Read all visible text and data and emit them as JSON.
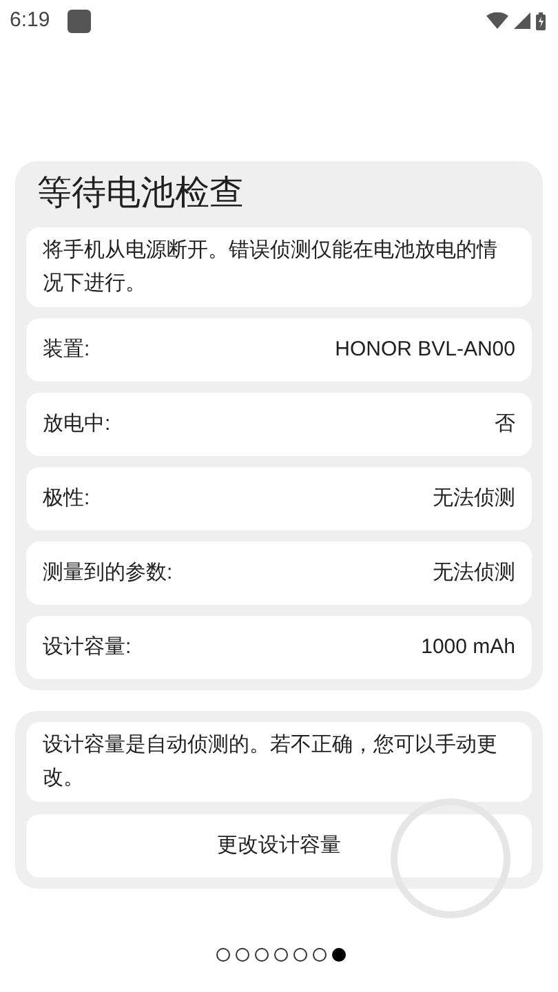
{
  "status_bar": {
    "time": "6:19"
  },
  "check_card": {
    "title": "等待电池检查",
    "message": "将手机从电源断开。错误侦测仅能在电池放电的情况下进行。",
    "rows": [
      {
        "label": "装置:",
        "value": "HONOR BVL-AN00"
      },
      {
        "label": "放电中:",
        "value": "否"
      },
      {
        "label": "极性:",
        "value": "无法侦测"
      },
      {
        "label": "测量到的参数:",
        "value": "无法侦测"
      },
      {
        "label": "设计容量:",
        "value": "1000 mAh"
      }
    ]
  },
  "capacity_card": {
    "message": "设计容量是自动侦测的。若不正确，您可以手动更改。",
    "button": "更改设计容量"
  },
  "pager": [
    {
      "selected": false
    },
    {
      "selected": false
    },
    {
      "selected": false
    },
    {
      "selected": false
    },
    {
      "selected": false
    },
    {
      "selected": false
    },
    {
      "selected": true
    }
  ]
}
